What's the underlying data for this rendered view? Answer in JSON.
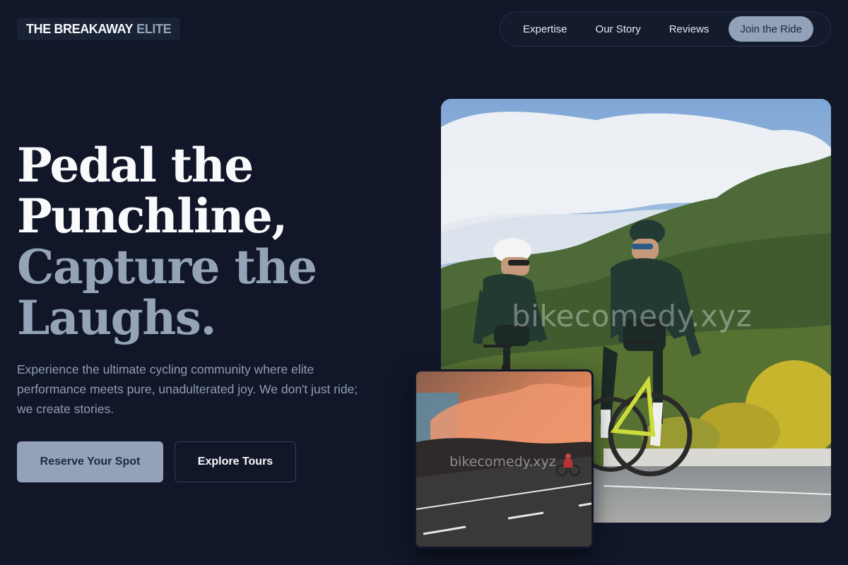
{
  "header": {
    "logo_primary": "THE BREAKAWAY",
    "logo_secondary": "ELITE",
    "nav": [
      {
        "label": "Expertise"
      },
      {
        "label": "Our Story"
      },
      {
        "label": "Reviews"
      }
    ],
    "cta_label": "Join the Ride"
  },
  "hero": {
    "title_line1": "Pedal the",
    "title_line2": "Punchline,",
    "title_line3": "Capture the",
    "title_line4": "Laughs.",
    "description": "Experience the ultimate cycling community where elite performance meets pure, unadulterated joy. We don't just ride; we create stories.",
    "primary_button": "Reserve Your Spot",
    "secondary_button": "Explore Tours"
  },
  "images": {
    "main_watermark": "bikecomedy.xyz",
    "small_watermark": "bikecomedy.xyz"
  },
  "colors": {
    "background": "#111729",
    "accent": "#93a2b8",
    "muted_text": "#94a3b8"
  }
}
